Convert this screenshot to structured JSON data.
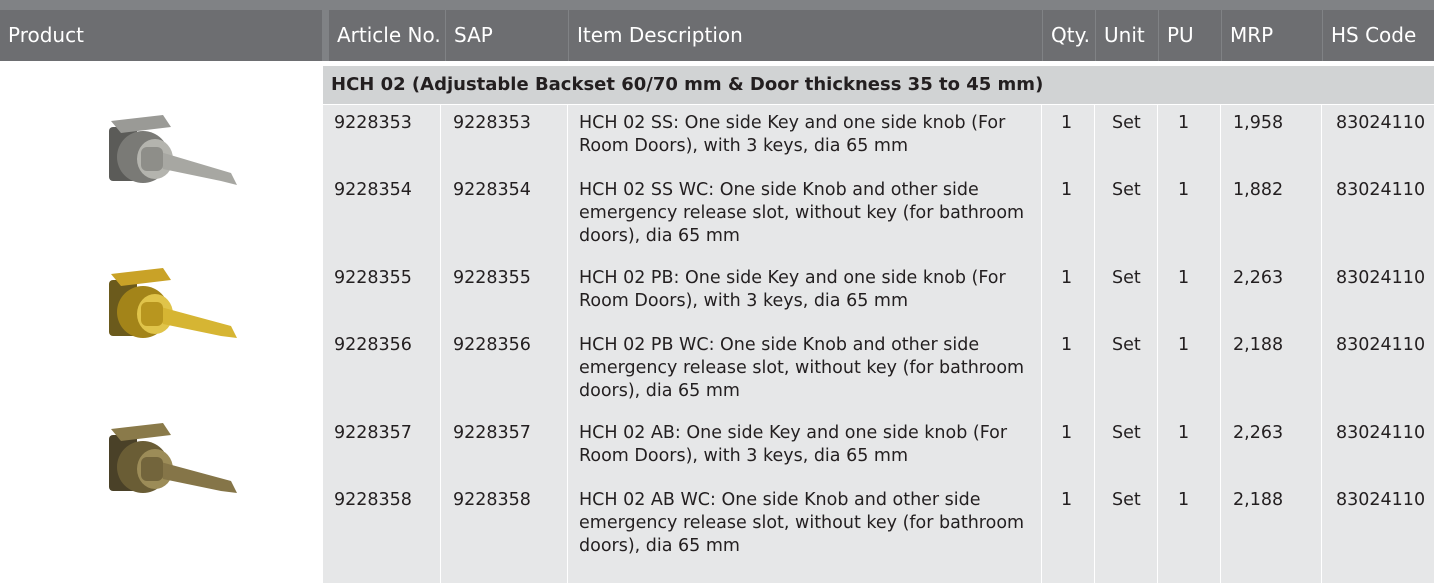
{
  "columns": {
    "product": "Product",
    "article": "Article No.",
    "sap": "SAP",
    "description": "Item Description",
    "qty": "Qty.",
    "unit": "Unit",
    "pu": "PU",
    "mrp": "MRP",
    "hs": "HS Code"
  },
  "group_title": "HCH 02 (Adjustable Backset 60/70 mm & Door thickness 35 to 45 mm)",
  "rows": [
    {
      "article": "9228353",
      "sap": "9228353",
      "description": "HCH 02 SS: One side Key and one side knob (For Room Doors), with 3 keys, dia 65 mm",
      "qty": "1",
      "unit": "Set",
      "pu": "1",
      "mrp": "1,958",
      "hs": "83024110"
    },
    {
      "article": "9228354",
      "sap": "9228354",
      "description": "HCH 02 SS WC: One side Knob and other side emergency release slot, without key (for bathroom doors), dia 65 mm",
      "qty": "1",
      "unit": "Set",
      "pu": "1",
      "mrp": "1,882",
      "hs": "83024110"
    },
    {
      "article": "9228355",
      "sap": "9228355",
      "description": "HCH 02 PB: One side Key and one side knob (For Room Doors), with 3 keys, dia 65 mm",
      "qty": "1",
      "unit": "Set",
      "pu": "1",
      "mrp": "2,263",
      "hs": "83024110"
    },
    {
      "article": "9228356",
      "sap": "9228356",
      "description": "HCH 02 PB WC: One side Knob and other side emergency release slot, without key (for bathroom doors), dia 65 mm",
      "qty": "1",
      "unit": "Set",
      "pu": "1",
      "mrp": "2,188",
      "hs": "83024110"
    },
    {
      "article": "9228357",
      "sap": "9228357",
      "description": "HCH 02 AB: One side Key and one side knob (For Room Doors), with 3 keys, dia 65 mm",
      "qty": "1",
      "unit": "Set",
      "pu": "1",
      "mrp": "2,263",
      "hs": "83024110"
    },
    {
      "article": "9228358",
      "sap": "9228358",
      "description": "HCH 02 AB WC: One side Knob and other side emergency release slot, without key (for bathroom doors), dia 65 mm",
      "qty": "1",
      "unit": "Set",
      "pu": "1",
      "mrp": "2,188",
      "hs": "83024110"
    }
  ],
  "product_images": [
    {
      "icon": "lever-lock-satin-steel-icon",
      "finish_color": "#9a9a96"
    },
    {
      "icon": "lever-lock-polished-brass-icon",
      "finish_color": "#c9a227"
    },
    {
      "icon": "lever-lock-antique-brass-icon",
      "finish_color": "#8a7a4a"
    }
  ]
}
